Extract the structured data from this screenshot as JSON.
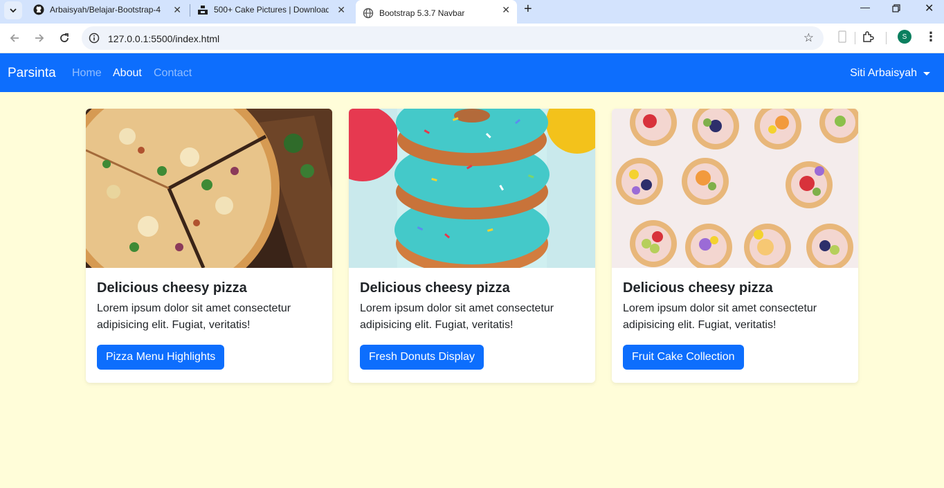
{
  "browser": {
    "tabs": [
      {
        "title": "Arbaisyah/Belajar-Bootstrap-4",
        "icon": "github-icon"
      },
      {
        "title": "500+ Cake Pictures | Download",
        "icon": "unsplash-icon"
      },
      {
        "title": "Bootstrap 5.3.7 Navbar",
        "icon": "globe-icon"
      }
    ],
    "url": "127.0.0.1:5500/index.html",
    "profile_initial": "S"
  },
  "navbar": {
    "brand": "Parsinta",
    "links": [
      {
        "label": "Home",
        "active": false
      },
      {
        "label": "About",
        "active": true
      },
      {
        "label": "Contact",
        "active": false
      }
    ],
    "user": "Siti Arbaisyah"
  },
  "cards": [
    {
      "image": "pizza",
      "title": "Delicious cheesy pizza",
      "text": "Lorem ipsum dolor sit amet consectetur adipisicing elit. Fugiat, veritatis!",
      "button": "Pizza Menu Highlights"
    },
    {
      "image": "donuts",
      "title": "Delicious cheesy pizza",
      "text": "Lorem ipsum dolor sit amet consectetur adipisicing elit. Fugiat, veritatis!",
      "button": "Fresh Donuts Display"
    },
    {
      "image": "fruit-tarts",
      "title": "Delicious cheesy pizza",
      "text": "Lorem ipsum dolor sit amet consectetur adipisicing elit. Fugiat, veritatis!",
      "button": "Fruit Cake Collection"
    }
  ],
  "colors": {
    "primary": "#0d6efd",
    "page_bg": "#fffdd9"
  }
}
